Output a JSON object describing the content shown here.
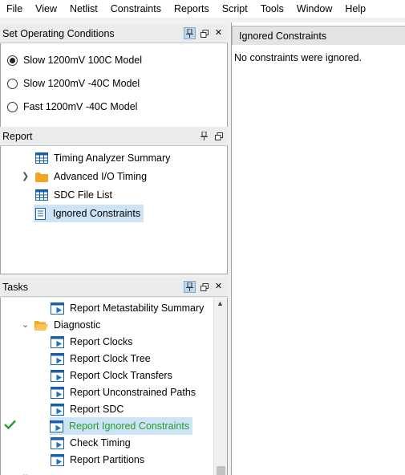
{
  "menu": [
    "File",
    "View",
    "Netlist",
    "Constraints",
    "Reports",
    "Script",
    "Tools",
    "Window",
    "Help"
  ],
  "operating_conditions": {
    "title": "Set Operating Conditions",
    "options": [
      {
        "label": "Slow 1200mV 100C Model",
        "selected": true
      },
      {
        "label": "Slow 1200mV -40C Model",
        "selected": false
      },
      {
        "label": "Fast 1200mV -40C Model",
        "selected": false
      }
    ]
  },
  "report": {
    "title": "Report",
    "items": [
      {
        "label": "Timing Analyzer Summary",
        "icon": "table-icon"
      },
      {
        "label": "Advanced I/O Timing",
        "icon": "folder-icon",
        "expandable": true
      },
      {
        "label": "SDC File List",
        "icon": "table-icon"
      },
      {
        "label": "Ignored Constraints",
        "icon": "document-icon",
        "selected": true
      }
    ]
  },
  "tasks": {
    "title": "Tasks",
    "items": [
      {
        "label": "Report Metastability Summary",
        "level": 2
      },
      {
        "label": "Diagnostic",
        "level": 1,
        "folder": true,
        "expanded": true
      },
      {
        "label": "Report Clocks",
        "level": 2
      },
      {
        "label": "Report Clock Tree",
        "level": 2
      },
      {
        "label": "Report Clock Transfers",
        "level": 2
      },
      {
        "label": "Report Unconstrained Paths",
        "level": 2
      },
      {
        "label": "Report SDC",
        "level": 2
      },
      {
        "label": "Report Ignored Constraints",
        "level": 2,
        "selected": true,
        "status": "success"
      },
      {
        "label": "Check Timing",
        "level": 2
      },
      {
        "label": "Report Partitions",
        "level": 2
      }
    ]
  },
  "right_panel": {
    "tab": "Ignored Constraints",
    "message": "No constraints were ignored."
  },
  "colors": {
    "accent": "#1a74c9",
    "selection": "#cde4f7",
    "success": "#2a9a2a",
    "folder": "#f4a521"
  }
}
